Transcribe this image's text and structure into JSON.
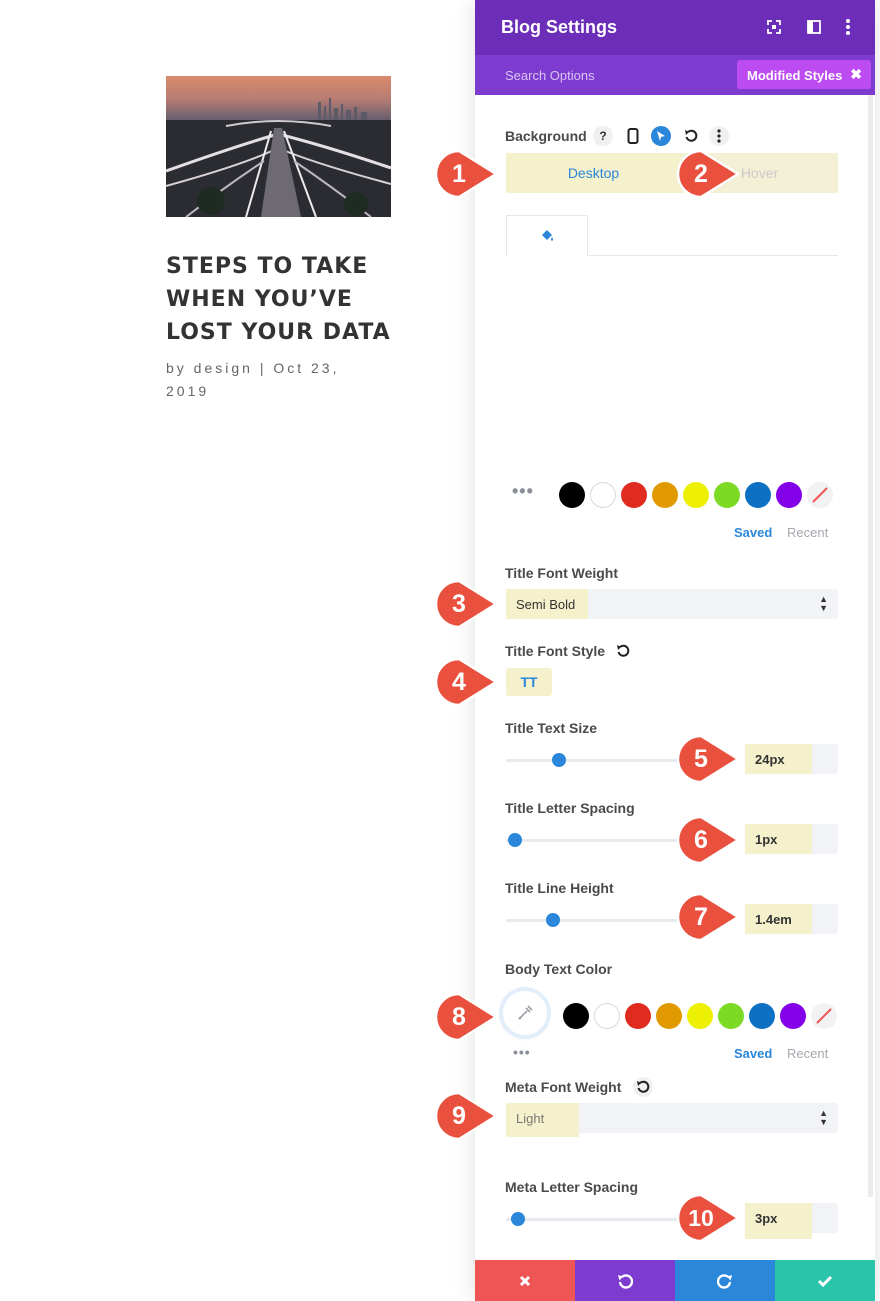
{
  "post": {
    "title": "STEPS TO TAKE WHEN YOU’VE LOST YOUR DATA",
    "meta": "by design | Oct 23, 2019",
    "image_icon": "highway-interchange-photo"
  },
  "panel": {
    "title": "Blog Settings",
    "header_icons": [
      "expand-icon",
      "columns-icon",
      "more-vertical-icon"
    ],
    "search_placeholder": "Search Options",
    "modified_styles_label": "Modified Styles",
    "modified_styles_close": "✖",
    "background": {
      "label": "Background",
      "help": "?",
      "tabs": {
        "desktop": "Desktop",
        "hover": "Hover"
      },
      "bg_tab_icon": "paint-bucket-icon"
    },
    "swatches": {
      "colors": [
        "#000000",
        "#ffffff",
        "#e02b20",
        "#e09900",
        "#edf000",
        "#7cda24",
        "#0c71c3",
        "#8300e9"
      ],
      "saved": "Saved",
      "recent": "Recent"
    },
    "title_font_weight": {
      "label": "Title Font Weight",
      "value": "Semi Bold"
    },
    "title_font_style": {
      "label": "Title Font Style",
      "button": "TT"
    },
    "title_text_size": {
      "label": "Title Text Size",
      "value": "24px",
      "slider_fraction": 0.3
    },
    "title_letter_spacing": {
      "label": "Title Letter Spacing",
      "value": "1px",
      "slider_fraction": 0.05
    },
    "title_line_height": {
      "label": "Title Line Height",
      "value": "1.4em",
      "slider_fraction": 0.27
    },
    "body_text_color": {
      "label": "Body Text Color",
      "saved": "Saved",
      "recent": "Recent"
    },
    "meta_font_weight": {
      "label": "Meta Font Weight",
      "value": "Light"
    },
    "meta_letter_spacing": {
      "label": "Meta Letter Spacing",
      "value": "3px",
      "slider_fraction": 0.07
    }
  },
  "callouts": [
    "1",
    "2",
    "3",
    "4",
    "5",
    "6",
    "7",
    "8",
    "9",
    "10"
  ],
  "colors": {
    "header": "#6c2eb9",
    "search_bar": "#7e3bd0",
    "modified_button": "#bc4cf2",
    "accent_blue": "#2b87da",
    "highlight": "#f5f1cc",
    "callout_red": "#e9503d",
    "footer": [
      "#ef5555",
      "#7d3bcf",
      "#2b87da",
      "#29c4a9"
    ]
  },
  "footer": {
    "buttons": [
      "cancel-icon",
      "undo-icon",
      "redo-icon",
      "save-check-icon"
    ]
  }
}
